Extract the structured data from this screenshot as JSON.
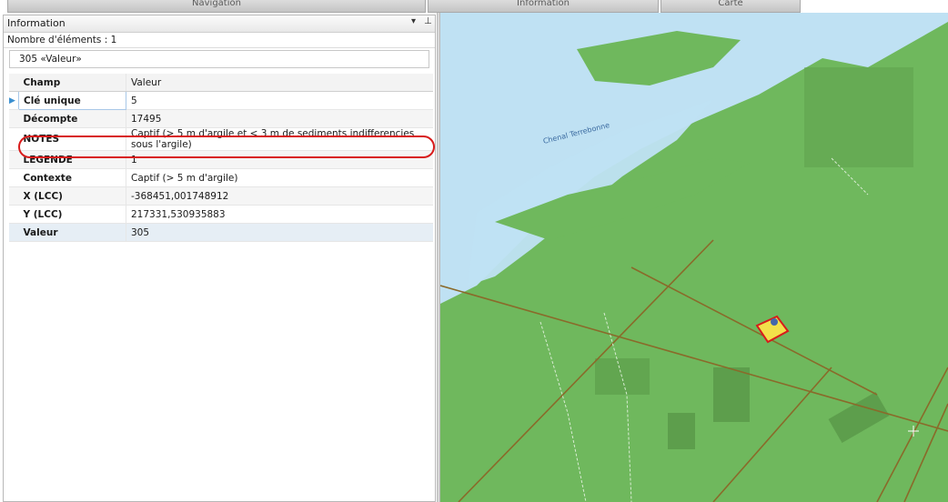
{
  "top_tabs": [
    "Navigation",
    "Information",
    "Carte"
  ],
  "panel": {
    "title": "Information",
    "dropdown_glyph": "▾",
    "pin_glyph": "⊥",
    "count_text": "Nombre d'éléments : 1",
    "item_label": "305  «Valeur»"
  },
  "table": {
    "headers": [
      "Champ",
      "Valeur"
    ],
    "rows": [
      {
        "field": "Clé unique",
        "value": "5"
      },
      {
        "field": "Décompte",
        "value": "17495"
      },
      {
        "field": "NOTES",
        "value": "Captif (> 5 m d'argile et < 3 m de sediments indifferencies sous l'argile)"
      },
      {
        "field": "LEGENDE",
        "value": "1"
      },
      {
        "field": "Contexte",
        "value": "Captif (> 5 m d'argile)"
      },
      {
        "field": "X (LCC)",
        "value": "-368451,001748912"
      },
      {
        "field": "Y (LCC)",
        "value": "217331,530935883"
      },
      {
        "field": "Valeur",
        "value": "305"
      }
    ]
  },
  "map": {
    "label": "Chenal Terrebonne",
    "water_color": "#bfe1f3",
    "land_color": "#6fb85d",
    "road_color": "#8a6a2a",
    "highlight_color": "#d81b1b"
  }
}
